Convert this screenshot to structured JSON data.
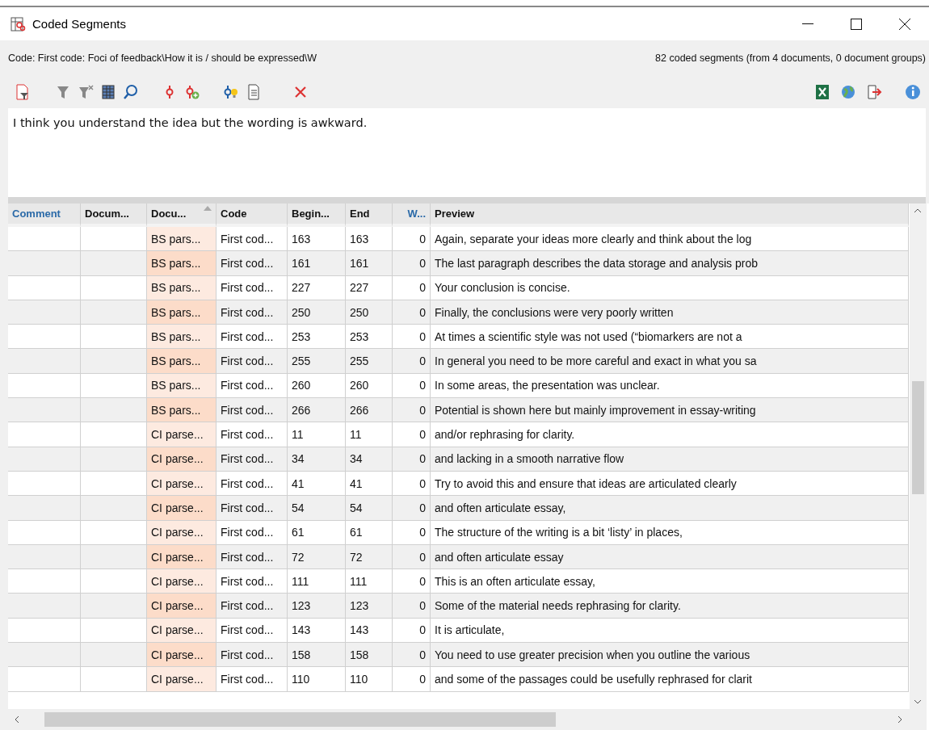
{
  "window": {
    "title": "Coded Segments"
  },
  "info": {
    "code": "Code: First code: Foci of feedback\\How it is / should be expressed\\W",
    "count": "82 coded segments (from 4 documents, 0 document groups)"
  },
  "comment_text": "I think you understand the idea but the wording is awkward.",
  "table": {
    "columns": [
      {
        "label": "Comment",
        "highlight": true,
        "sorted": false
      },
      {
        "label": "Docum...",
        "highlight": false,
        "sorted": false
      },
      {
        "label": "Docu...",
        "highlight": false,
        "sorted": true
      },
      {
        "label": "Code",
        "highlight": false,
        "sorted": false
      },
      {
        "label": "Begin...",
        "highlight": false,
        "sorted": false
      },
      {
        "label": "End",
        "highlight": false,
        "sorted": false
      },
      {
        "label": "W...",
        "highlight": true,
        "sorted": false
      },
      {
        "label": "Preview",
        "highlight": false,
        "sorted": false
      }
    ],
    "rows": [
      [
        "",
        "",
        "BS pars...",
        "First cod...",
        "163",
        "163",
        "0",
        "Again, separate your ideas more clearly and think about the log"
      ],
      [
        "",
        "",
        "BS pars...",
        "First cod...",
        "161",
        "161",
        "0",
        "The last paragraph describes the data storage and analysis prob"
      ],
      [
        "",
        "",
        "BS pars...",
        "First cod...",
        "227",
        "227",
        "0",
        "Your conclusion is concise."
      ],
      [
        "",
        "",
        "BS pars...",
        "First cod...",
        "250",
        "250",
        "0",
        "Finally, the conclusions were very poorly written"
      ],
      [
        "",
        "",
        "BS pars...",
        "First cod...",
        "253",
        "253",
        "0",
        "At times a scientific style was not used (“biomarkers are not a"
      ],
      [
        "",
        "",
        "BS pars...",
        "First cod...",
        "255",
        "255",
        "0",
        "In general you need to be more careful and exact in what you sa"
      ],
      [
        "",
        "",
        "BS pars...",
        "First cod...",
        "260",
        "260",
        "0",
        "In some areas, the presentation was unclear."
      ],
      [
        "",
        "",
        "BS pars...",
        "First cod...",
        "266",
        "266",
        "0",
        "Potential is shown here but mainly improvement in essay-writing"
      ],
      [
        "",
        "",
        "CI parse...",
        "First cod...",
        "11",
        "11",
        "0",
        "and/or rephrasing for clarity."
      ],
      [
        "",
        "",
        "CI parse...",
        "First cod...",
        "34",
        "34",
        "0",
        "and lacking in a smooth narrative flow"
      ],
      [
        "",
        "",
        "CI parse...",
        "First cod...",
        "41",
        "41",
        "0",
        "Try to avoid this and ensure that ideas are articulated clearly"
      ],
      [
        "",
        "",
        "CI parse...",
        "First cod...",
        "54",
        "54",
        "0",
        "and often articulate essay,"
      ],
      [
        "",
        "",
        "CI parse...",
        "First cod...",
        "61",
        "61",
        "0",
        "The structure of the writing is a bit ‘listy’ in places,"
      ],
      [
        "",
        "",
        "CI parse...",
        "First cod...",
        "72",
        "72",
        "0",
        "and often articulate essay"
      ],
      [
        "",
        "",
        "CI parse...",
        "First cod...",
        "111",
        "111",
        "0",
        "This is an often articulate essay,"
      ],
      [
        "",
        "",
        "CI parse...",
        "First cod...",
        "123",
        "123",
        "0",
        "Some of the material needs rephrasing for clarity."
      ],
      [
        "",
        "",
        "CI parse...",
        "First cod...",
        "143",
        "143",
        "0",
        "It is articulate,"
      ],
      [
        "",
        "",
        "CI parse...",
        "First cod...",
        "158",
        "158",
        "0",
        "You need to use greater precision when you outline the various"
      ],
      [
        "",
        "",
        "CI parse...",
        "First cod...",
        "110",
        "110",
        "0",
        "and some of the passages could be usefully rephrased for clarit"
      ]
    ]
  }
}
